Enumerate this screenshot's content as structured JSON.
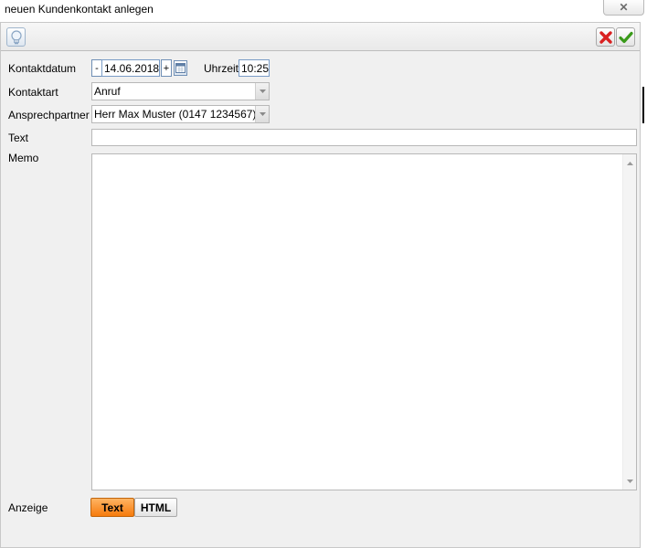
{
  "window": {
    "title": "neuen Kundenkontakt anlegen",
    "close_icon": "close-icon"
  },
  "toolbar": {
    "tip_icon": "lightbulb-icon",
    "cancel_icon": "red-x-icon",
    "ok_icon": "green-check-icon"
  },
  "form": {
    "kontaktdatum_label": "Kontaktdatum",
    "date_minus_label": "-",
    "date_value": "14.06.2018",
    "date_plus_label": "+",
    "calendar_icon": "calendar-icon",
    "uhrzeit_label": "Uhrzeit",
    "time_value": "10:25",
    "kontaktart_label": "Kontaktart",
    "kontaktart_value": "Anruf",
    "ansprechpartner_label": "Ansprechpartner",
    "ansprechpartner_value": "Herr Max Muster (0147 1234567)",
    "text_label": "Text",
    "text_value": "",
    "memo_label": "Memo",
    "memo_value": "",
    "anzeige_label": "Anzeige",
    "anzeige_options": [
      "Text",
      "HTML"
    ],
    "anzeige_selected": "Text"
  },
  "colors": {
    "dialog_bg": "#f0f0f0",
    "toggle_active": "#f67a0c",
    "cancel_red": "#d92020",
    "ok_green": "#3a9a1a"
  }
}
